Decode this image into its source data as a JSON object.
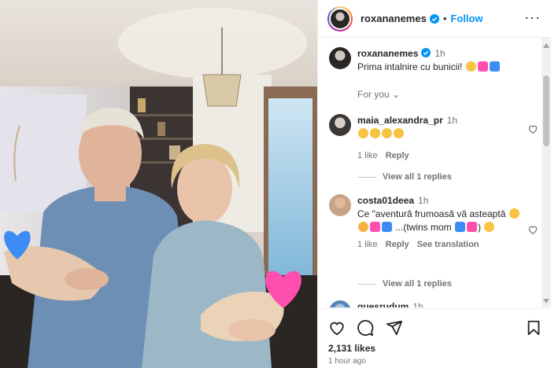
{
  "post": {
    "username": "roxananemes",
    "dot": "•",
    "follow_label": "Follow",
    "more_label": "···",
    "caption_user": "roxananemes",
    "caption_time": "1h",
    "caption_text": "Prima intalnire cu bunicii!",
    "likes": "2,131 likes",
    "posted": "1 hour ago"
  },
  "for_you": "For you",
  "comments": [
    {
      "user": "maia_alexandra_pr",
      "time": "1h",
      "text": "",
      "likes": "1 like",
      "reply": "Reply",
      "view_replies": "View all 1 replies"
    },
    {
      "user": "costa01deea",
      "time": "1h",
      "text": "Ce \"aventură frumoasă vă asteaptă",
      "text_tail": "...(twins mom",
      "likes": "1 like",
      "reply": "Reply",
      "see_translation": "See translation",
      "view_replies": "View all 1 replies"
    },
    {
      "user": "quesrudum",
      "time": "1h"
    }
  ],
  "colors": {
    "follow_blue": "#0095f6",
    "verified_blue": "#0095f6",
    "heart_pink": "#ff4fae"
  },
  "icons": [
    "heart-icon",
    "comment-icon",
    "share-icon",
    "bookmark-icon",
    "verified-icon"
  ]
}
